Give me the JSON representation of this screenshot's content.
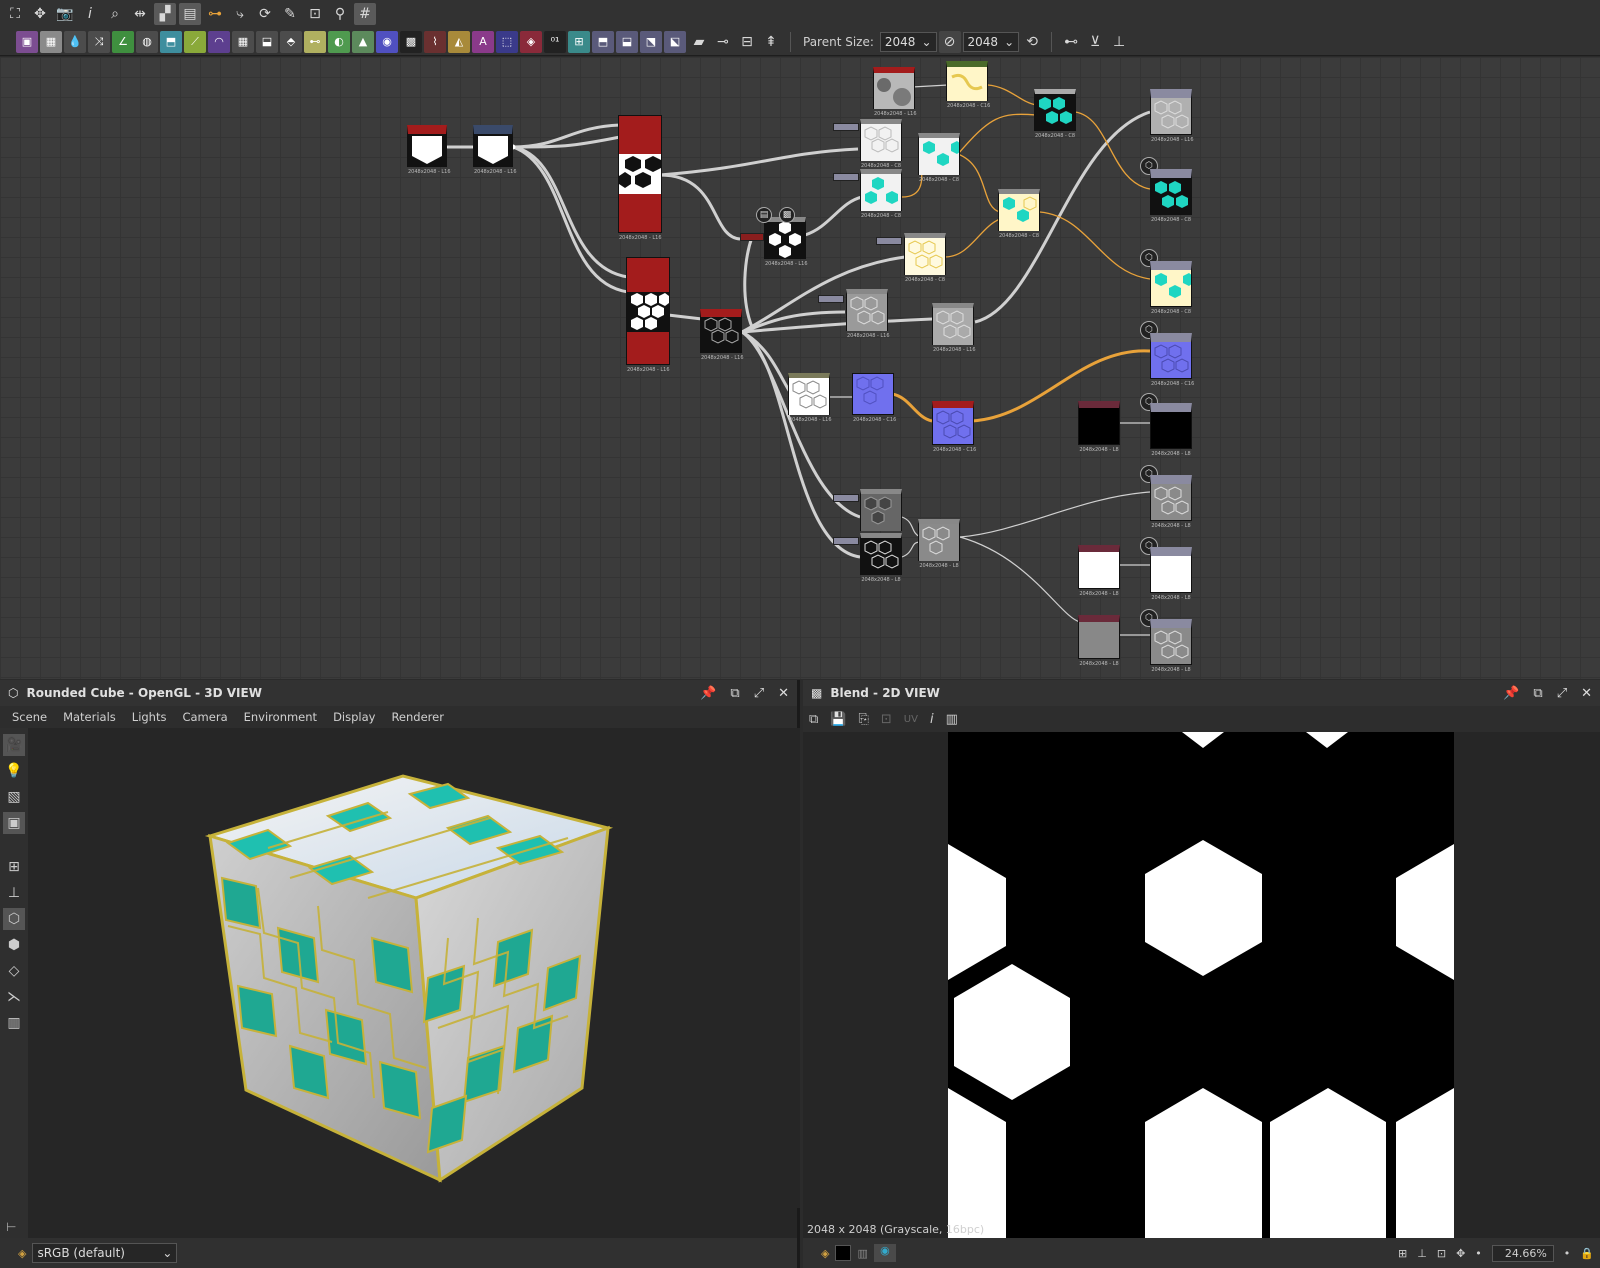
{
  "toolbar": {
    "parent_size_label": "Parent Size:",
    "parent_size_w": "2048",
    "parent_size_h": "2048"
  },
  "graph": {
    "node_label_l16": "2048x2048 - L16",
    "node_label_c8": "2048x2048 - C8",
    "node_label_c16": "2048x2048 - C16",
    "node_label_l8": "2048x2048 - L8"
  },
  "view3d": {
    "title": "Rounded Cube - OpenGL - 3D VIEW",
    "menu": [
      "Scene",
      "Materials",
      "Lights",
      "Camera",
      "Environment",
      "Display",
      "Renderer"
    ],
    "colorspace": "sRGB (default)"
  },
  "view2d": {
    "title": "Blend - 2D VIEW",
    "uv_label": "UV",
    "image_info": "2048 x 2048 (Grayscale, 16bpc)",
    "zoom": "24.66%"
  },
  "colors": {
    "accent_orange": "#e8a23a",
    "node_red": "#a31c1c",
    "teal": "#1fd6c2",
    "purple": "#6a6ae6"
  }
}
